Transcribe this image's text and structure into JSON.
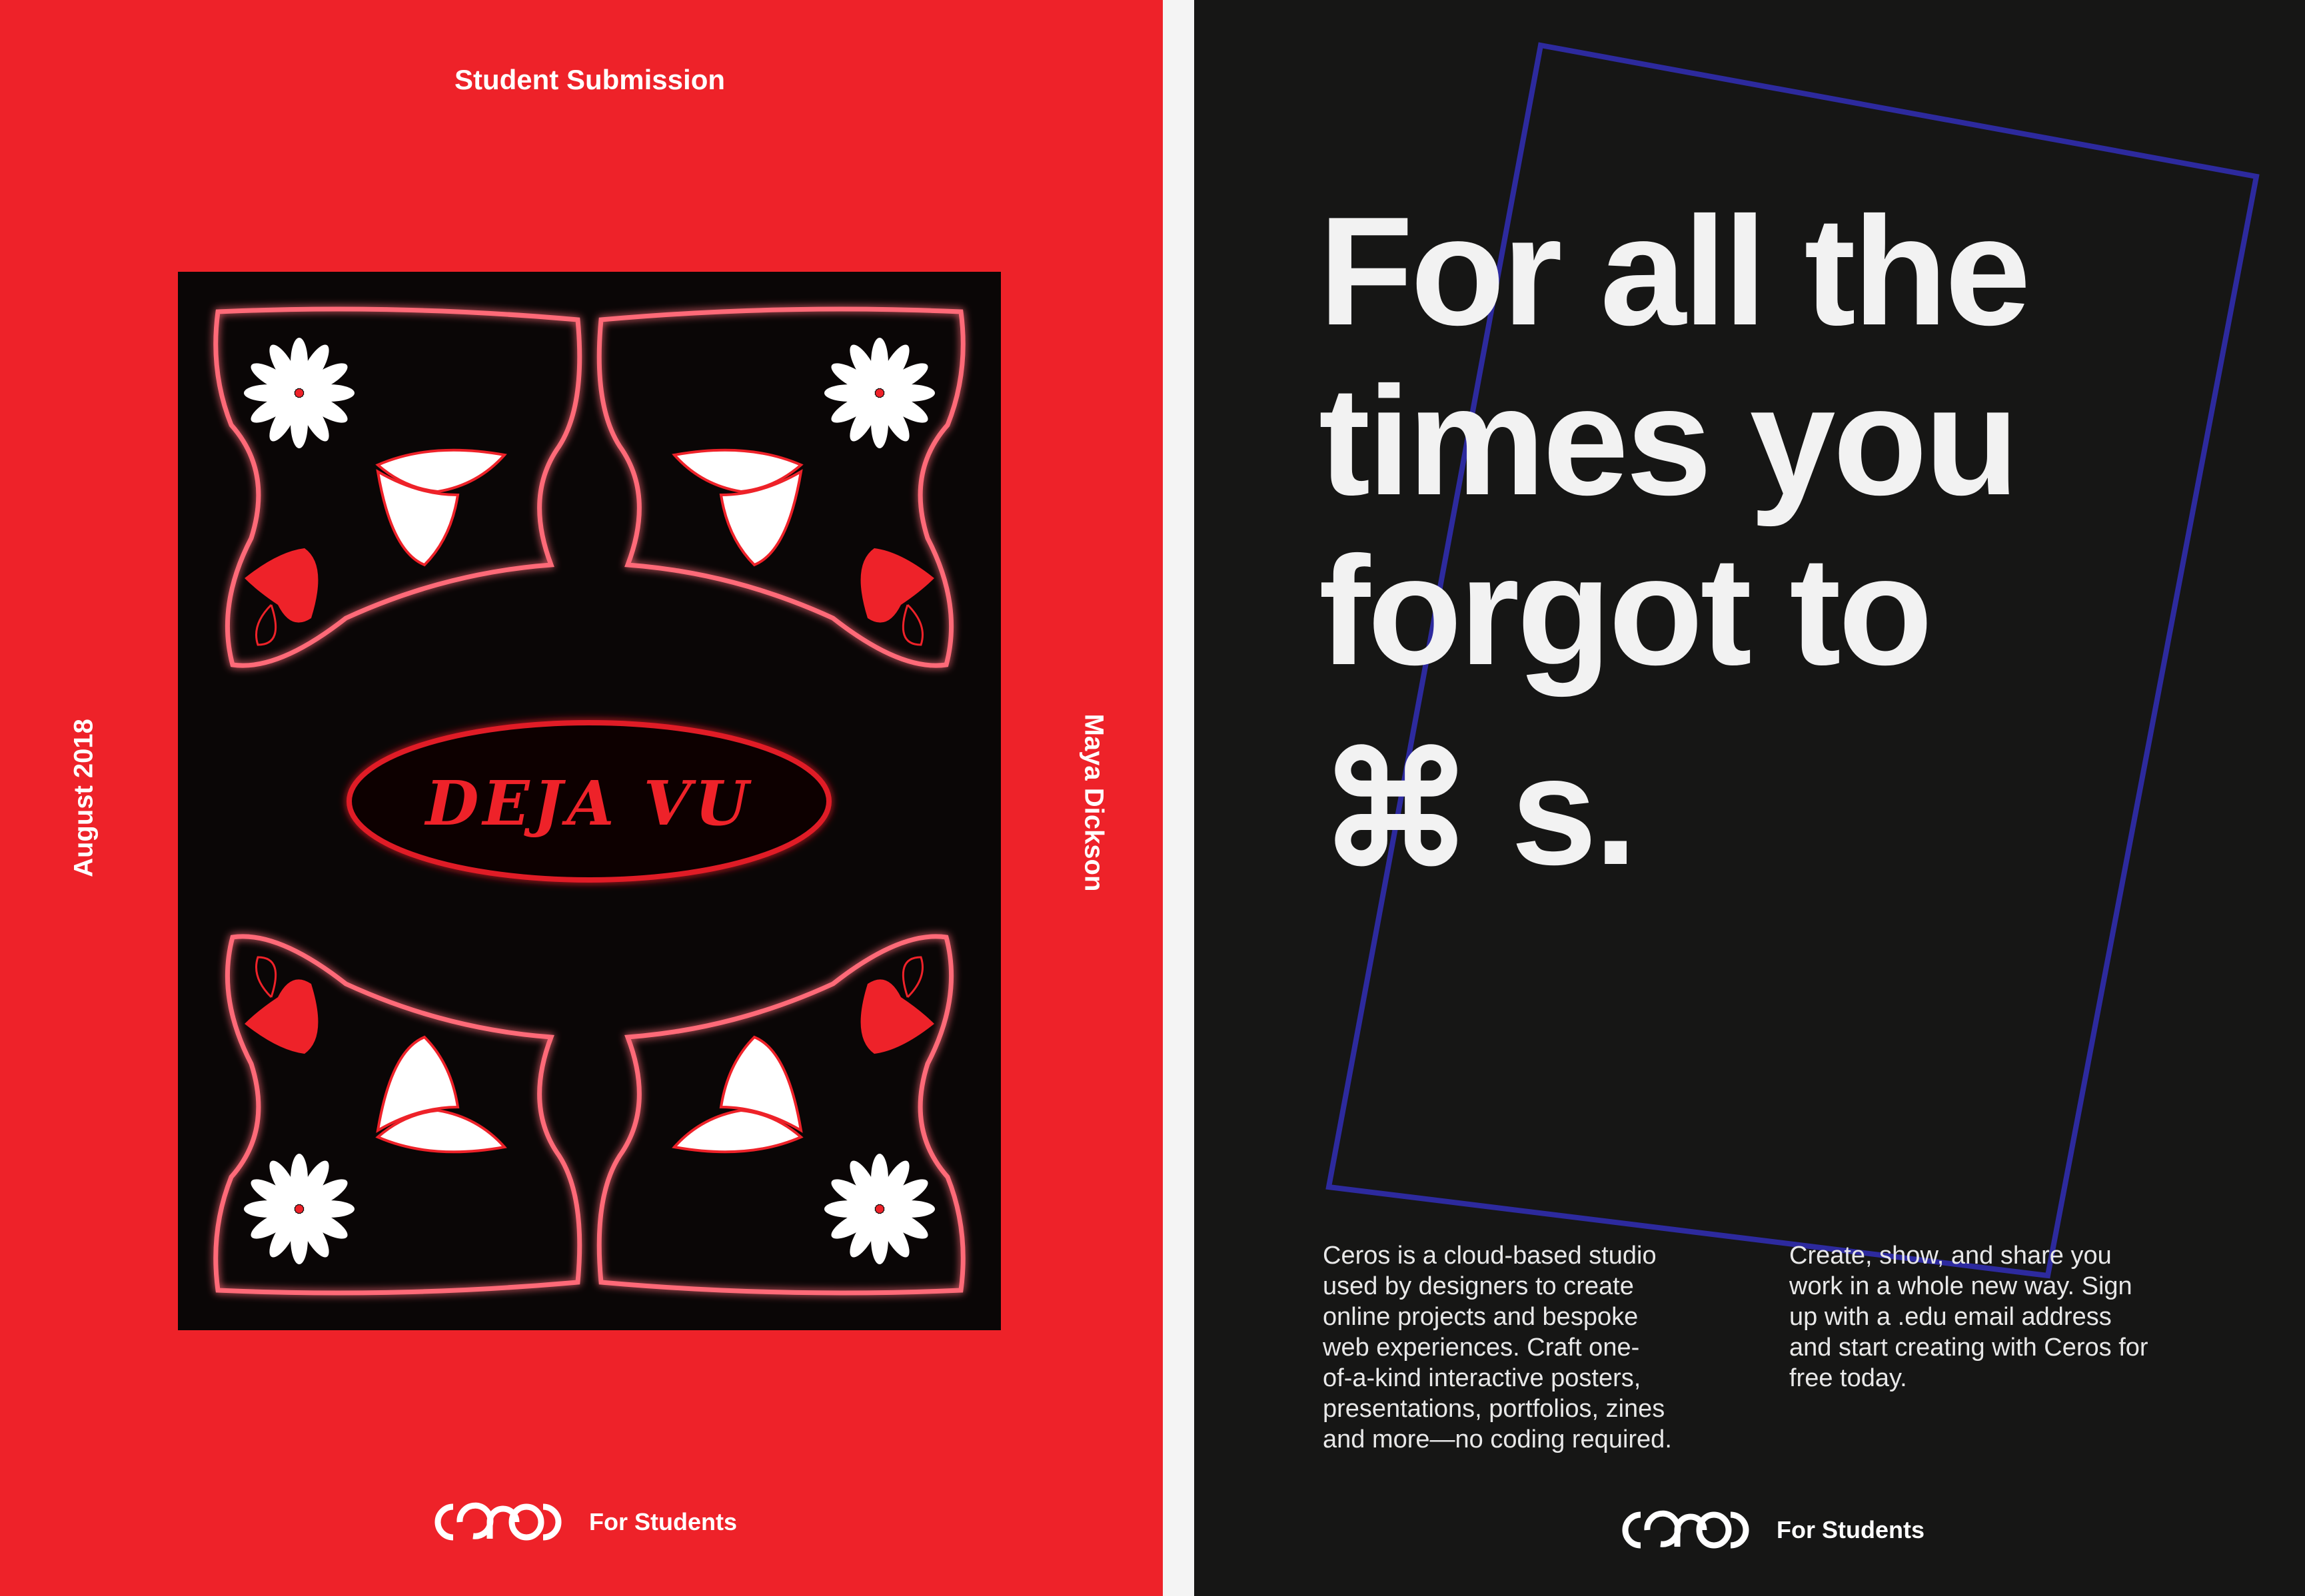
{
  "left_card": {
    "title": "Student Submission",
    "date": "August 2018",
    "author": "Maya Dickson",
    "poster": {
      "title": "DEJA VU"
    },
    "footer": {
      "logo": "ceros",
      "label": "For Students"
    },
    "colors": {
      "background": "#ee2229",
      "poster_bg": "#0a0606",
      "glow": "#ff4a5a"
    }
  },
  "right_card": {
    "headline": [
      "For all the",
      "times you",
      "forgot to",
      "⌘ s."
    ],
    "body_left": [
      "Ceros is a cloud-based studio",
      "used by designers to create",
      "online projects and bespoke",
      "web experiences. Craft one-",
      "of-a-kind interactive posters,",
      "presentations, portfolios, zines",
      "and more—no coding required."
    ],
    "body_right": [
      "Create, show, and share you",
      "work in a whole new way. Sign",
      "up with a .edu email address",
      "and start creating with Ceros for",
      "free today."
    ],
    "footer": {
      "logo": "ceros",
      "label": "For Students"
    },
    "colors": {
      "background": "#161615",
      "frame": "#2d2a9e",
      "text": "#f2f2f2"
    }
  }
}
